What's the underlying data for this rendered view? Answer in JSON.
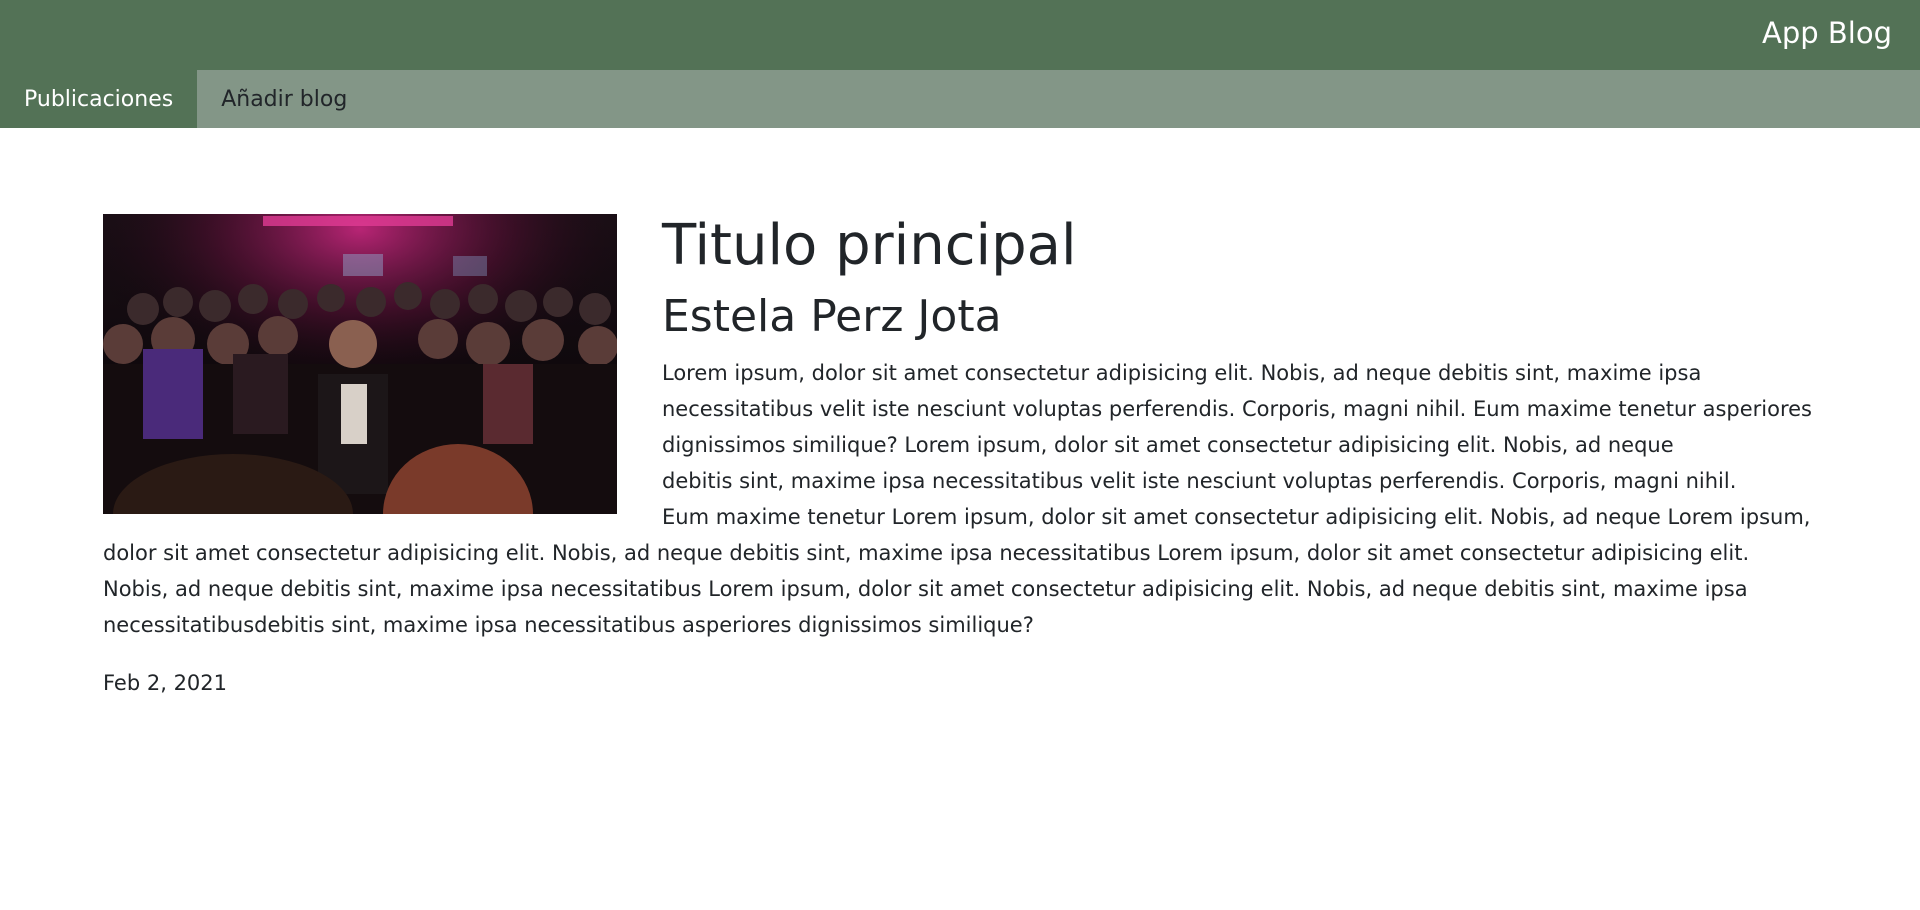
{
  "header": {
    "brand": "App Blog"
  },
  "nav": {
    "tabs": [
      {
        "label": "Publicaciones",
        "active": true
      },
      {
        "label": "Añadir blog",
        "active": false
      }
    ]
  },
  "post": {
    "image_alt": "concert crowd photo",
    "title": "Titulo principal",
    "author": "Estela Perz Jota",
    "body": "Lorem ipsum, dolor sit amet consectetur adipisicing elit. Nobis, ad neque debitis sint, maxime ipsa necessitatibus velit iste nesciunt voluptas perferendis. Corporis, magni nihil. Eum maxime tenetur asperiores dignissimos similique? Lorem ipsum, dolor sit amet consectetur adipisicing elit. Nobis, ad neque\n debitis sint, maxime ipsa necessitatibus velit iste nesciunt voluptas perferendis. Corporis, magni nihil.\n Eum maxime tenetur Lorem ipsum, dolor sit amet consectetur adipisicing elit. Nobis, ad neque  Lorem ipsum, dolor sit amet consectetur adipisicing elit. Nobis, ad neque debitis sint, maxime ipsa necessitatibus Lorem ipsum, dolor sit amet consectetur adipisicing elit. Nobis, ad neque debitis sint, maxime ipsa necessitatibus Lorem ipsum, dolor sit amet consectetur adipisicing elit. Nobis, ad neque debitis sint, maxime ipsa necessitatibusdebitis sint, maxime ipsa necessitatibus asperiores dignissimos similique?",
    "date": "Feb 2, 2021"
  },
  "colors": {
    "header_bg": "#537256",
    "nav_bg": "#839687",
    "active_tab_bg": "#537256"
  }
}
